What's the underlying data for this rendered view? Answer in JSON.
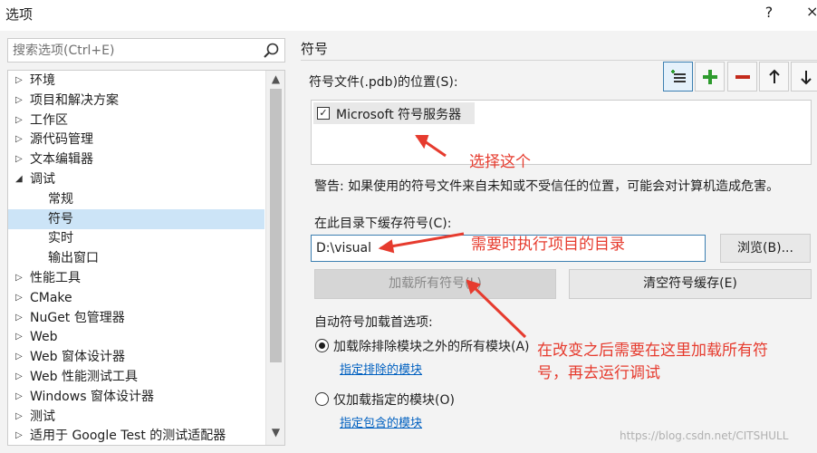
{
  "window": {
    "title": "选项",
    "help_label": "?",
    "close_label": "×"
  },
  "search": {
    "placeholder": "搜索选项(Ctrl+E)"
  },
  "tree": {
    "items": [
      {
        "label": "环境",
        "caret": "▷"
      },
      {
        "label": "项目和解决方案",
        "caret": "▷"
      },
      {
        "label": "工作区",
        "caret": "▷"
      },
      {
        "label": "源代码管理",
        "caret": "▷"
      },
      {
        "label": "文本编辑器",
        "caret": "▷"
      },
      {
        "label": "调试",
        "caret": "◢"
      },
      {
        "label": "常规",
        "caret": ""
      },
      {
        "label": "符号",
        "caret": ""
      },
      {
        "label": "实时",
        "caret": ""
      },
      {
        "label": "输出窗口",
        "caret": ""
      },
      {
        "label": "性能工具",
        "caret": "▷"
      },
      {
        "label": "CMake",
        "caret": "▷"
      },
      {
        "label": "NuGet 包管理器",
        "caret": "▷"
      },
      {
        "label": "Web",
        "caret": "▷"
      },
      {
        "label": "Web 窗体设计器",
        "caret": "▷"
      },
      {
        "label": "Web 性能测试工具",
        "caret": "▷"
      },
      {
        "label": "Windows 窗体设计器",
        "caret": "▷"
      },
      {
        "label": "测试",
        "caret": "▷"
      },
      {
        "label": "适用于 Google Test 的测试适配器",
        "caret": "▷"
      }
    ],
    "selected_label": "符号",
    "scroll_up": "▲",
    "scroll_down": "▼"
  },
  "panel": {
    "section_title": "符号",
    "symbol_locations_label": "符号文件(.pdb)的位置(S):",
    "toolbar": {
      "plus_color": "#2e9b2e",
      "minus_color": "#c42b1c"
    },
    "locations": [
      {
        "label": "Microsoft 符号服务器",
        "checked": "✓"
      }
    ],
    "warning": "警告: 如果使用的符号文件来自未知或不受信任的位置，可能会对计算机造成危害。",
    "cache_label": "在此目录下缓存符号(C):",
    "cache_path": "D:\\visual",
    "browse_label": "浏览(B)...",
    "load_all_label": "加载所有符号(L)",
    "clear_cache_label": "清空符号缓存(E)",
    "autoload_label": "自动符号加载首选项:",
    "option_all_label": "加载除排除模块之外的所有模块(A)",
    "option_all_link": "指定排除的模块",
    "option_specified_label": "仅加载指定的模块(O)",
    "option_specified_link": "指定包含的模块"
  },
  "annotations": {
    "color": "#e63b2e",
    "choose_this": "选择这个",
    "dir_note": "需要时执行项目的目录",
    "load_note_line1": "在改变之后需要在这里加载所有符",
    "load_note_line2": "号，再去运行调试"
  },
  "watermark": "https://blog.csdn.net/CITSHULL"
}
